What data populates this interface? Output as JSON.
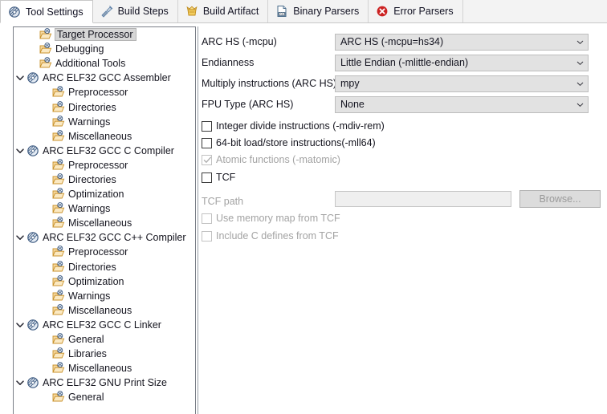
{
  "tabs": [
    {
      "label": "Tool Settings",
      "icon": "tool-settings-icon",
      "active": true
    },
    {
      "label": "Build Steps",
      "icon": "build-steps-icon",
      "active": false
    },
    {
      "label": "Build Artifact",
      "icon": "build-artifact-icon",
      "active": false
    },
    {
      "label": "Binary Parsers",
      "icon": "binary-parsers-icon",
      "active": false
    },
    {
      "label": "Error Parsers",
      "icon": "error-parsers-icon",
      "active": false
    }
  ],
  "tree": [
    {
      "label": "Target Processor",
      "indent": 1,
      "icon": "folder-icon",
      "chevron": "none",
      "selected": true
    },
    {
      "label": "Debugging",
      "indent": 1,
      "icon": "folder-icon",
      "chevron": "none",
      "selected": false
    },
    {
      "label": "Additional Tools",
      "indent": 1,
      "icon": "folder-icon",
      "chevron": "none",
      "selected": false
    },
    {
      "label": "ARC ELF32 GCC Assembler",
      "indent": 0,
      "icon": "tool-icon",
      "chevron": "down",
      "selected": false
    },
    {
      "label": "Preprocessor",
      "indent": 2,
      "icon": "folder-icon",
      "chevron": "none",
      "selected": false
    },
    {
      "label": "Directories",
      "indent": 2,
      "icon": "folder-icon",
      "chevron": "none",
      "selected": false
    },
    {
      "label": "Warnings",
      "indent": 2,
      "icon": "folder-icon",
      "chevron": "none",
      "selected": false
    },
    {
      "label": "Miscellaneous",
      "indent": 2,
      "icon": "folder-icon",
      "chevron": "none",
      "selected": false
    },
    {
      "label": "ARC ELF32 GCC C Compiler",
      "indent": 0,
      "icon": "tool-icon",
      "chevron": "down",
      "selected": false
    },
    {
      "label": "Preprocessor",
      "indent": 2,
      "icon": "folder-icon",
      "chevron": "none",
      "selected": false
    },
    {
      "label": "Directories",
      "indent": 2,
      "icon": "folder-icon",
      "chevron": "none",
      "selected": false
    },
    {
      "label": "Optimization",
      "indent": 2,
      "icon": "folder-icon",
      "chevron": "none",
      "selected": false
    },
    {
      "label": "Warnings",
      "indent": 2,
      "icon": "folder-icon",
      "chevron": "none",
      "selected": false
    },
    {
      "label": "Miscellaneous",
      "indent": 2,
      "icon": "folder-icon",
      "chevron": "none",
      "selected": false
    },
    {
      "label": "ARC ELF32 GCC C++ Compiler",
      "indent": 0,
      "icon": "tool-icon",
      "chevron": "down",
      "selected": false
    },
    {
      "label": "Preprocessor",
      "indent": 2,
      "icon": "folder-icon",
      "chevron": "none",
      "selected": false
    },
    {
      "label": "Directories",
      "indent": 2,
      "icon": "folder-icon",
      "chevron": "none",
      "selected": false
    },
    {
      "label": "Optimization",
      "indent": 2,
      "icon": "folder-icon",
      "chevron": "none",
      "selected": false
    },
    {
      "label": "Warnings",
      "indent": 2,
      "icon": "folder-icon",
      "chevron": "none",
      "selected": false
    },
    {
      "label": "Miscellaneous",
      "indent": 2,
      "icon": "folder-icon",
      "chevron": "none",
      "selected": false
    },
    {
      "label": "ARC ELF32 GCC C Linker",
      "indent": 0,
      "icon": "tool-icon",
      "chevron": "down",
      "selected": false
    },
    {
      "label": "General",
      "indent": 2,
      "icon": "folder-icon",
      "chevron": "none",
      "selected": false
    },
    {
      "label": "Libraries",
      "indent": 2,
      "icon": "folder-icon",
      "chevron": "none",
      "selected": false
    },
    {
      "label": "Miscellaneous",
      "indent": 2,
      "icon": "folder-icon",
      "chevron": "none",
      "selected": false
    },
    {
      "label": "ARC ELF32 GNU Print Size",
      "indent": 0,
      "icon": "tool-icon",
      "chevron": "down",
      "selected": false
    },
    {
      "label": "General",
      "indent": 2,
      "icon": "folder-icon",
      "chevron": "none",
      "selected": false
    }
  ],
  "form": {
    "combos": [
      {
        "label": "ARC HS (-mcpu)",
        "value": "ARC HS (-mcpu=hs34)"
      },
      {
        "label": "Endianness",
        "value": "Little Endian (-mlittle-endian)"
      },
      {
        "label": "Multiply instructions (ARC HS)",
        "value": "mpy"
      },
      {
        "label": "FPU Type (ARC HS)",
        "value": "None"
      }
    ],
    "checkboxes": [
      {
        "label": "Integer divide instructions (-mdiv-rem)",
        "checked": false,
        "disabled": false
      },
      {
        "label": "64-bit load/store instructions(-mll64)",
        "checked": false,
        "disabled": false
      },
      {
        "label": "Atomic functions (-matomic)",
        "checked": true,
        "disabled": true
      },
      {
        "label": "TCF",
        "checked": false,
        "disabled": false
      }
    ],
    "tcf_path": {
      "label": "TCF path",
      "value": "",
      "browse_label": "Browse...",
      "disabled": true
    },
    "tcf_checkboxes": [
      {
        "label": "Use memory map from TCF",
        "checked": false,
        "disabled": true
      },
      {
        "label": "Include C defines from TCF",
        "checked": false,
        "disabled": true
      }
    ]
  },
  "colors": {
    "tabbar_bg": "#f3f3f3",
    "active_tab_bg": "#ffffff",
    "combo_bg": "#e2e2e2",
    "selection_bg": "#d6d6d6",
    "folder_icon": "#f0c070",
    "tool_icon": "#5b7fa6",
    "error_icon": "#cc2222",
    "artifact_icon": "#e8b83a"
  }
}
